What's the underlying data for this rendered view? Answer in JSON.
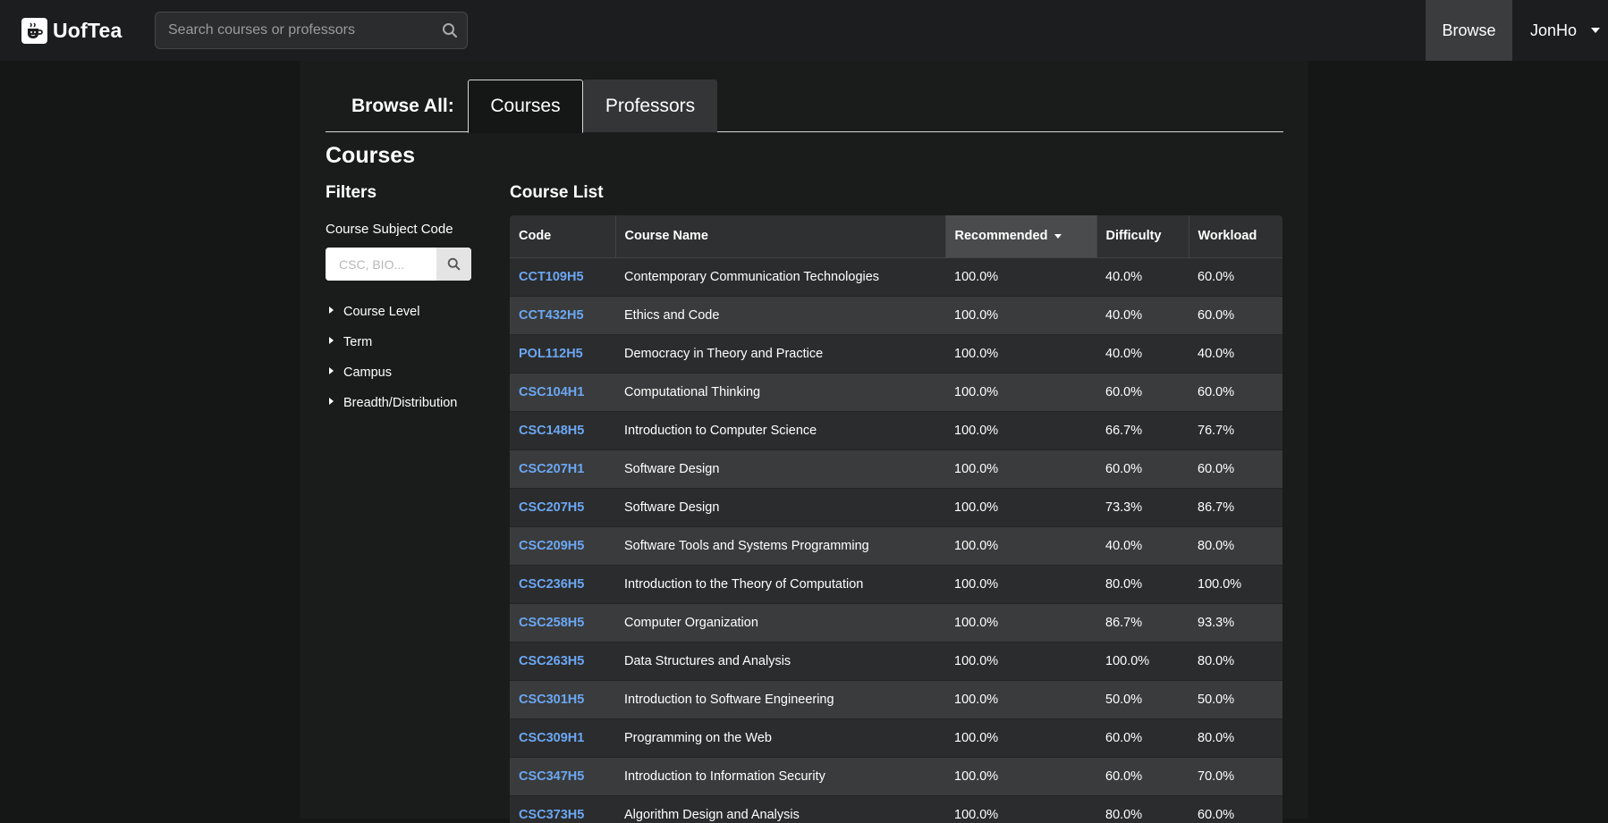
{
  "navbar": {
    "brand": "UofTea",
    "search_placeholder": "Search courses or professors",
    "browse_label": "Browse",
    "user_label": "JonHo"
  },
  "tabs": {
    "prefix": "Browse All:",
    "courses": "Courses",
    "professors": "Professors",
    "active": "Courses"
  },
  "page_title": "Courses",
  "filters": {
    "title": "Filters",
    "subject_label": "Course Subject Code",
    "subject_placeholder": "CSC, BIO...",
    "items": [
      "Course Level",
      "Term",
      "Campus",
      "Breadth/Distribution"
    ]
  },
  "course_list": {
    "title": "Course List",
    "columns": [
      "Code",
      "Course Name",
      "Recommended",
      "Difficulty",
      "Workload"
    ],
    "sorted_column": "Recommended",
    "rows": [
      [
        "CCT109H5",
        "Contemporary Communication Technologies",
        "100.0%",
        "40.0%",
        "60.0%"
      ],
      [
        "CCT432H5",
        "Ethics and Code",
        "100.0%",
        "40.0%",
        "60.0%"
      ],
      [
        "POL112H5",
        "Democracy in Theory and Practice",
        "100.0%",
        "40.0%",
        "40.0%"
      ],
      [
        "CSC104H1",
        "Computational Thinking",
        "100.0%",
        "60.0%",
        "60.0%"
      ],
      [
        "CSC148H5",
        "Introduction to Computer Science",
        "100.0%",
        "66.7%",
        "76.7%"
      ],
      [
        "CSC207H1",
        "Software Design",
        "100.0%",
        "60.0%",
        "60.0%"
      ],
      [
        "CSC207H5",
        "Software Design",
        "100.0%",
        "73.3%",
        "86.7%"
      ],
      [
        "CSC209H5",
        "Software Tools and Systems Programming",
        "100.0%",
        "40.0%",
        "80.0%"
      ],
      [
        "CSC236H5",
        "Introduction to the Theory of Computation",
        "100.0%",
        "80.0%",
        "100.0%"
      ],
      [
        "CSC258H5",
        "Computer Organization",
        "100.0%",
        "86.7%",
        "93.3%"
      ],
      [
        "CSC263H5",
        "Data Structures and Analysis",
        "100.0%",
        "100.0%",
        "80.0%"
      ],
      [
        "CSC301H5",
        "Introduction to Software Engineering",
        "100.0%",
        "50.0%",
        "50.0%"
      ],
      [
        "CSC309H1",
        "Programming on the Web",
        "100.0%",
        "60.0%",
        "80.0%"
      ],
      [
        "CSC347H5",
        "Introduction to Information Security",
        "100.0%",
        "60.0%",
        "70.0%"
      ],
      [
        "CSC373H5",
        "Algorithm Design and Analysis",
        "100.0%",
        "80.0%",
        "60.0%"
      ]
    ]
  },
  "colors": {
    "background": "#151616",
    "navbar": "#1c1d1f",
    "link": "#6ba7f3",
    "row_odd": "#2b2c2d",
    "row_even": "#3a3b3c",
    "sorted_header": "#4a4b4c"
  },
  "icons": {
    "logo": "tea-cup-icon",
    "search": "search-icon",
    "dropdown": "caret-down-icon",
    "filter_expand": "caret-right-icon",
    "sort": "sort-desc-icon"
  }
}
